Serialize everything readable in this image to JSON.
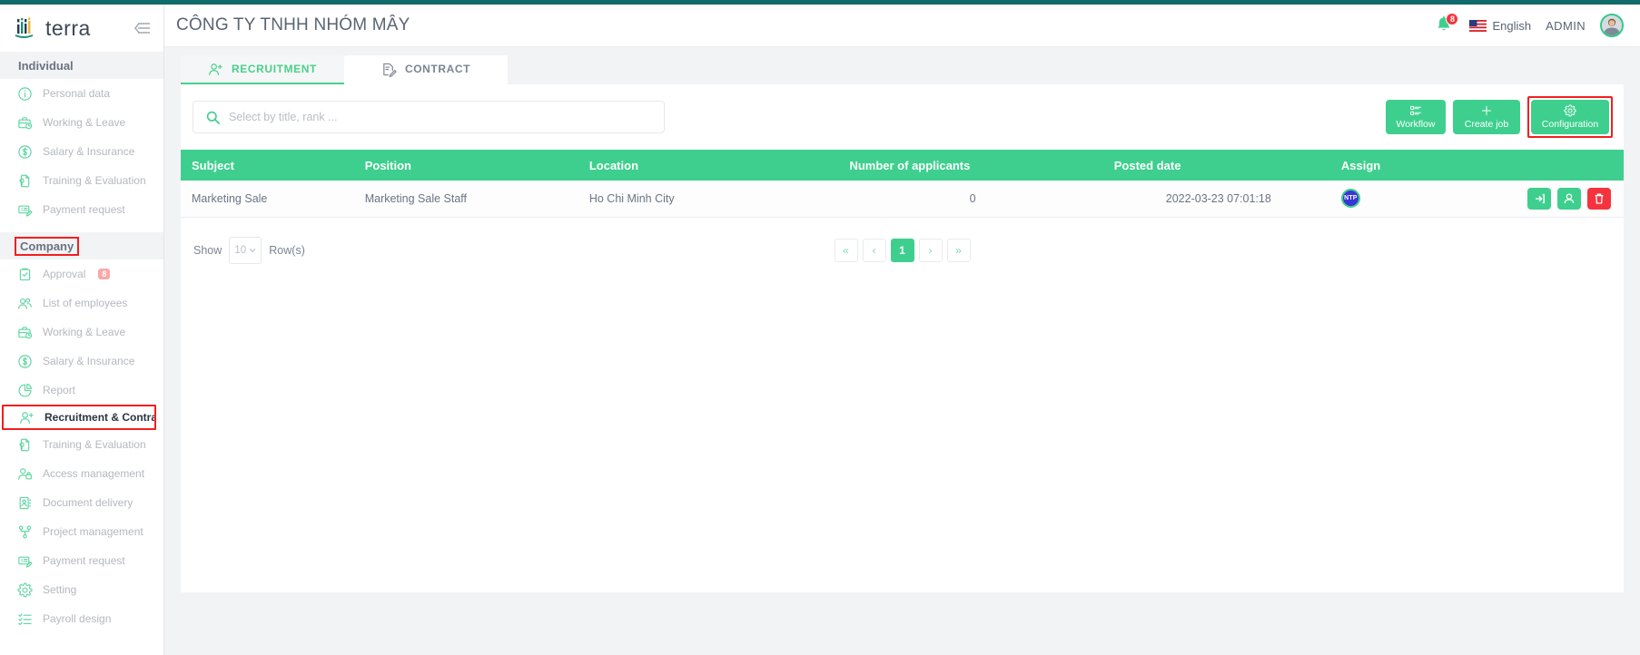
{
  "brand": {
    "name": "terra",
    "collapse_icon": "collapse-menu-icon"
  },
  "sidebar": {
    "sections": [
      {
        "title": "Individual",
        "highlighted": false,
        "items": [
          {
            "label": "Personal data",
            "icon": "info-circle-icon",
            "active": false,
            "boxed": false,
            "badge": ""
          },
          {
            "label": "Working & Leave",
            "icon": "briefcase-clock-icon",
            "active": false,
            "boxed": false,
            "badge": ""
          },
          {
            "label": "Salary & Insurance",
            "icon": "dollar-circle-icon",
            "active": false,
            "boxed": false,
            "badge": ""
          },
          {
            "label": "Training & Evaluation",
            "icon": "document-check-icon",
            "active": false,
            "boxed": false,
            "badge": ""
          },
          {
            "label": "Payment request",
            "icon": "invoice-edit-icon",
            "active": false,
            "boxed": false,
            "badge": ""
          }
        ]
      },
      {
        "title": "Company",
        "highlighted": true,
        "items": [
          {
            "label": "Approval",
            "icon": "clipboard-check-icon",
            "active": false,
            "boxed": false,
            "badge": "8"
          },
          {
            "label": "List of employees",
            "icon": "users-icon",
            "active": false,
            "boxed": false,
            "badge": ""
          },
          {
            "label": "Working & Leave",
            "icon": "briefcase-clock-icon",
            "active": false,
            "boxed": false,
            "badge": ""
          },
          {
            "label": "Salary & Insurance",
            "icon": "dollar-circle-icon",
            "active": false,
            "boxed": false,
            "badge": ""
          },
          {
            "label": "Report",
            "icon": "pie-chart-icon",
            "active": false,
            "boxed": false,
            "badge": ""
          },
          {
            "label": "Recruitment & Contract",
            "icon": "user-plus-icon",
            "active": true,
            "boxed": true,
            "badge": ""
          },
          {
            "label": "Training & Evaluation",
            "icon": "document-check-icon",
            "active": false,
            "boxed": false,
            "badge": ""
          },
          {
            "label": "Access management",
            "icon": "user-lock-icon",
            "active": false,
            "boxed": false,
            "badge": ""
          },
          {
            "label": "Document delivery",
            "icon": "contact-card-icon",
            "active": false,
            "boxed": false,
            "badge": ""
          },
          {
            "label": "Project management",
            "icon": "sitemap-icon",
            "active": false,
            "boxed": false,
            "badge": ""
          },
          {
            "label": "Payment request",
            "icon": "invoice-edit-icon",
            "active": false,
            "boxed": false,
            "badge": ""
          },
          {
            "label": "Setting",
            "icon": "gear-icon",
            "active": false,
            "boxed": false,
            "badge": ""
          },
          {
            "label": "Payroll design",
            "icon": "checklist-icon",
            "active": false,
            "boxed": false,
            "badge": ""
          }
        ]
      }
    ]
  },
  "header": {
    "title": "CÔNG TY TNHH NHÓM MÂY",
    "notification_count": "8",
    "language": "English",
    "user": "ADMIN",
    "bell_icon": "bell-icon",
    "flag_icon": "us-flag-icon",
    "avatar_icon": "user-avatar-icon"
  },
  "tabs": [
    {
      "label": "RECRUITMENT",
      "icon": "user-plus-icon",
      "active": true
    },
    {
      "label": "CONTRACT",
      "icon": "contract-edit-icon",
      "active": false
    }
  ],
  "toolbar": {
    "search_placeholder": "Select by title, rank ...",
    "search_value": "",
    "search_icon": "search-icon",
    "buttons": [
      {
        "label": "Workflow",
        "icon": "workflow-list-icon",
        "boxed": false
      },
      {
        "label": "Create job",
        "icon": "plus-icon",
        "boxed": false
      },
      {
        "label": "Configuration",
        "icon": "gear-icon",
        "boxed": true
      }
    ]
  },
  "table": {
    "columns": [
      "Subject",
      "Position",
      "Location",
      "Number of applicants",
      "Posted date",
      "Assign",
      ""
    ],
    "rows": [
      {
        "subject": "Marketing Sale",
        "position": "Marketing Sale Staff",
        "location": "Ho Chi Minh City",
        "applicants": "0",
        "posted_date": "2022-03-23 07:01:18",
        "assign_initials": "NTP",
        "actions": [
          "login-arrow-icon",
          "person-icon",
          "trash-icon"
        ]
      }
    ]
  },
  "footer": {
    "show_label": "Show",
    "rows_value": "10",
    "rows_label": "Row(s)",
    "pagination": [
      {
        "label": "«",
        "name": "first-page",
        "active": false
      },
      {
        "label": "‹",
        "name": "prev-page",
        "active": false
      },
      {
        "label": "1",
        "name": "page-1",
        "active": true
      },
      {
        "label": "›",
        "name": "next-page",
        "active": false
      },
      {
        "label": "»",
        "name": "last-page",
        "active": false
      }
    ]
  },
  "colors": {
    "brand_teal": "#106b6b",
    "accent_green": "#3ecf8e",
    "danger_red": "#f5333f",
    "highlight_red": "#f21f1f"
  }
}
